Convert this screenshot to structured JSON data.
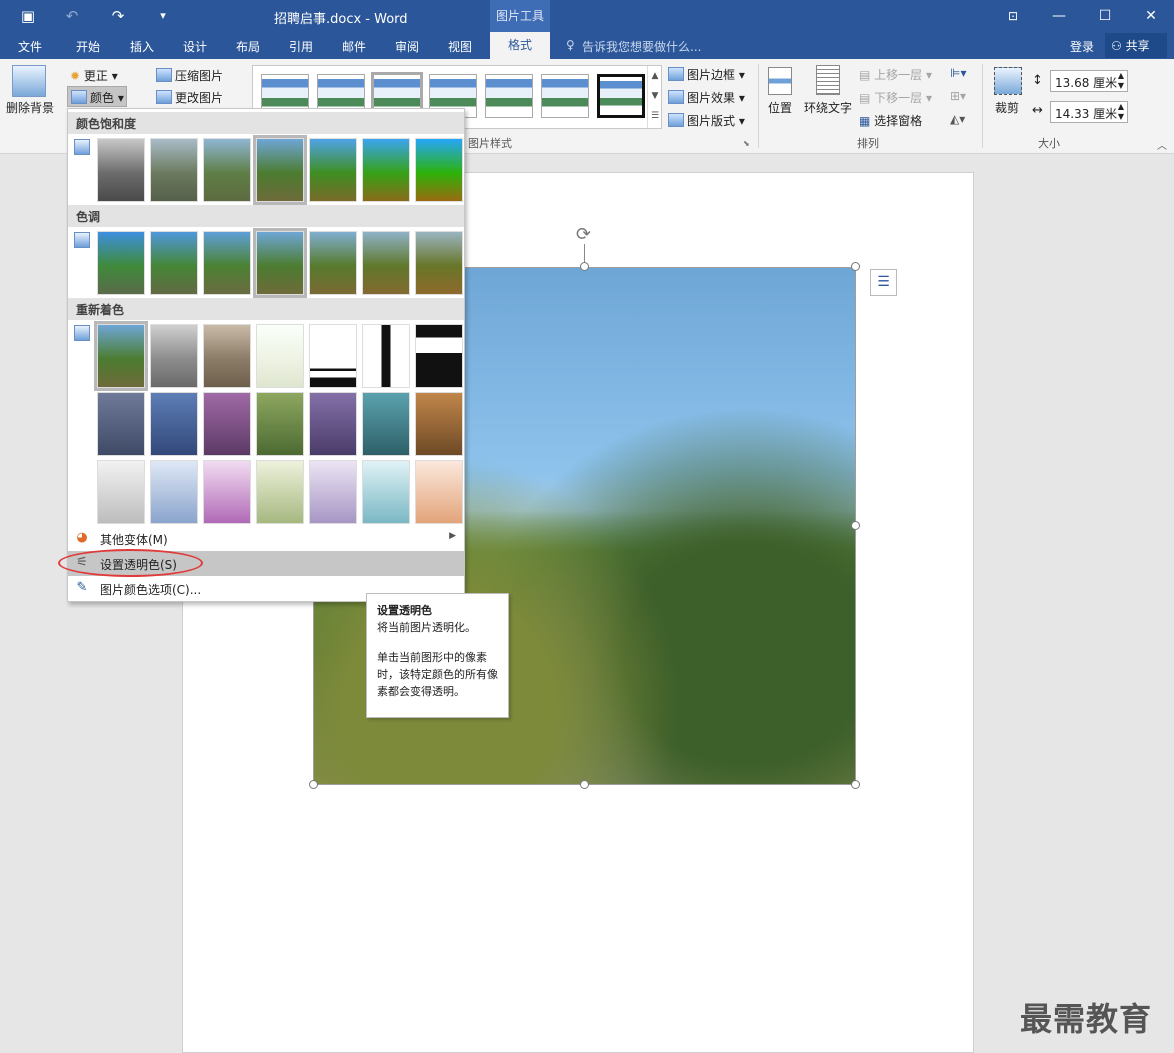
{
  "window": {
    "title": "招聘启事.docx - Word",
    "context_group": "图片工具"
  },
  "tabs": [
    "文件",
    "开始",
    "插入",
    "设计",
    "布局",
    "引用",
    "邮件",
    "审阅",
    "视图",
    "格式"
  ],
  "active_tab": "格式",
  "tell_me": "告诉我您想要做什么...",
  "account": {
    "login": "登录",
    "share": "共享"
  },
  "ribbon": {
    "remove_bg": "删除背景",
    "correct": "更正",
    "color": "颜色",
    "compress": "压缩图片",
    "change_pic": "更改图片",
    "pic_border": "图片边框",
    "pic_effect": "图片效果",
    "pic_layout": "图片版式",
    "group_styles": "图片样式",
    "position": "位置",
    "wrap_text": "环绕文字",
    "bring_forward": "上移一层",
    "send_backward": "下移一层",
    "selection_pane": "选择窗格",
    "group_arrange": "排列",
    "crop": "裁剪",
    "height": "13.68 厘米",
    "width": "14.33 厘米",
    "group_size": "大小"
  },
  "color_menu": {
    "saturation_header": "颜色饱和度",
    "tone_header": "色调",
    "recolor_header": "重新着色",
    "more_variants": "其他变体(M)",
    "set_transparent": "设置透明色(S)",
    "color_options": "图片颜色选项(C)..."
  },
  "tooltip": {
    "title": "设置透明色",
    "line1": "将当前图片透明化。",
    "line2": "单击当前图形中的像素时，该特定颜色的所有像素都会变得透明。"
  },
  "watermark": "最需教育",
  "colors": {
    "accent": "#2b579a",
    "highlight": "#c6c6c6",
    "annotation": "#e03a3a"
  }
}
